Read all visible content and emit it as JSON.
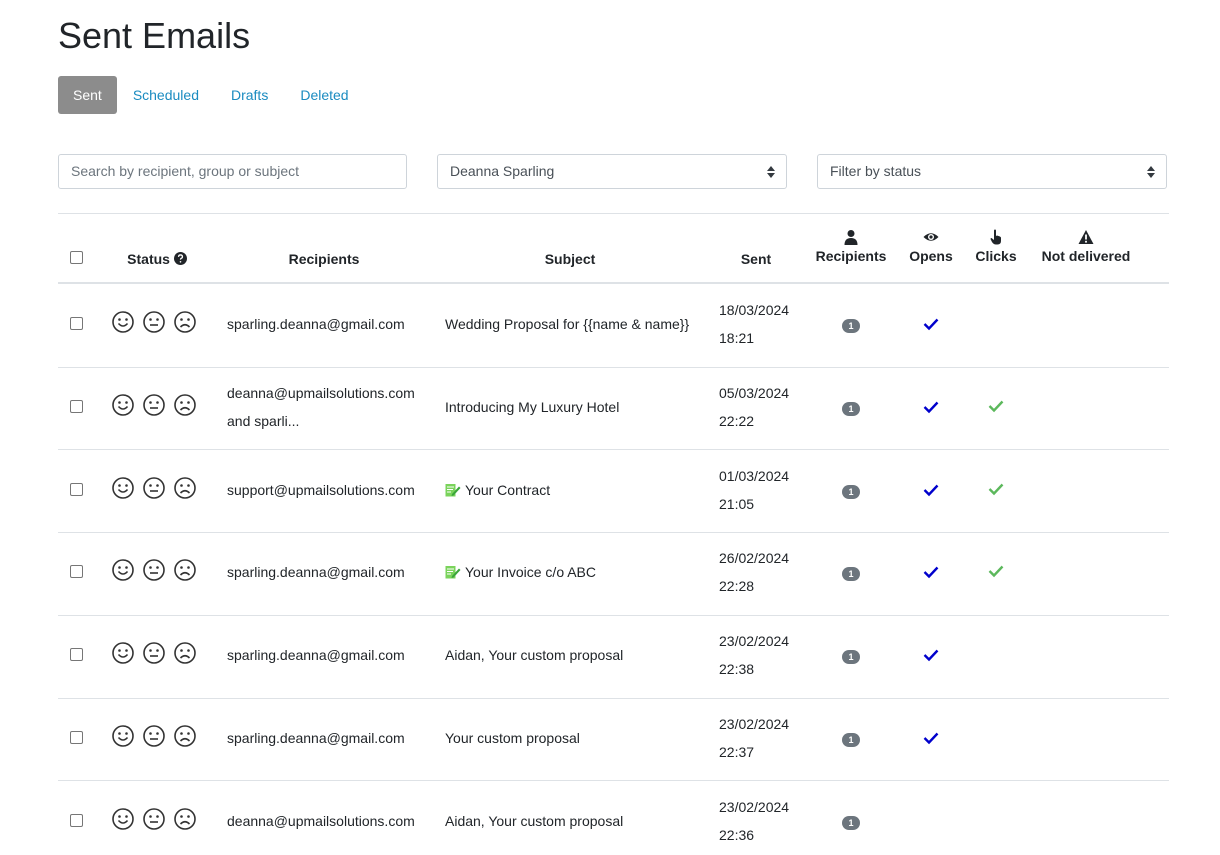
{
  "page": {
    "title": "Sent Emails"
  },
  "tabs": [
    {
      "label": "Sent",
      "active": true
    },
    {
      "label": "Scheduled",
      "active": false
    },
    {
      "label": "Drafts",
      "active": false
    },
    {
      "label": "Deleted",
      "active": false
    }
  ],
  "filters": {
    "search_placeholder": "Search by recipient, group or subject",
    "user_select_value": "Deanna Sparling",
    "status_select_placeholder": "Filter by status"
  },
  "table": {
    "headers": {
      "status": "Status",
      "recipients": "Recipients",
      "subject": "Subject",
      "sent": "Sent",
      "recipients_count": "Recipients",
      "opens": "Opens",
      "clicks": "Clicks",
      "not_delivered": "Not delivered"
    },
    "rows": [
      {
        "recipients_line1": "sparling.deanna@gmail.com",
        "recipients_line2": "",
        "subject": "Wedding Proposal for {{name & name}}",
        "subject_icon": false,
        "sent_date": "18/03/2024",
        "sent_time": "18:21",
        "recipients_count": "1",
        "opened": true,
        "clicked": false
      },
      {
        "recipients_line1": "deanna@upmailsolutions.com",
        "recipients_line2": "and sparli...",
        "subject": "Introducing My Luxury Hotel",
        "subject_icon": false,
        "sent_date": "05/03/2024",
        "sent_time": "22:22",
        "recipients_count": "1",
        "opened": true,
        "clicked": true
      },
      {
        "recipients_line1": "support@upmailsolutions.com",
        "recipients_line2": "",
        "subject": "Your Contract",
        "subject_icon": true,
        "sent_date": "01/03/2024",
        "sent_time": "21:05",
        "recipients_count": "1",
        "opened": true,
        "clicked": true
      },
      {
        "recipients_line1": "sparling.deanna@gmail.com",
        "recipients_line2": "",
        "subject": "Your Invoice c/o ABC",
        "subject_icon": true,
        "sent_date": "26/02/2024",
        "sent_time": "22:28",
        "recipients_count": "1",
        "opened": true,
        "clicked": true
      },
      {
        "recipients_line1": "sparling.deanna@gmail.com",
        "recipients_line2": "",
        "subject": "Aidan, Your custom proposal",
        "subject_icon": false,
        "sent_date": "23/02/2024",
        "sent_time": "22:38",
        "recipients_count": "1",
        "opened": true,
        "clicked": false
      },
      {
        "recipients_line1": "sparling.deanna@gmail.com",
        "recipients_line2": "",
        "subject": "Your custom proposal",
        "subject_icon": false,
        "sent_date": "23/02/2024",
        "sent_time": "22:37",
        "recipients_count": "1",
        "opened": true,
        "clicked": false
      },
      {
        "recipients_line1": "deanna@upmailsolutions.com",
        "recipients_line2": "",
        "subject": "Aidan, Your custom proposal",
        "subject_icon": false,
        "sent_date": "23/02/2024",
        "sent_time": "22:36",
        "recipients_count": "1",
        "opened": false,
        "clicked": false
      }
    ]
  },
  "icons": {
    "status_help": "question-circle-icon",
    "recipients": "user-icon",
    "opens": "eye-icon",
    "clicks": "pointer-hand-icon",
    "not_delivered": "warning-triangle-icon",
    "faces": [
      "smile-face-icon",
      "neutral-face-icon",
      "frown-face-icon"
    ],
    "opened": "blue-check-icon",
    "clicked": "green-check-icon",
    "subject_attachment": "signed-document-icon"
  },
  "colors": {
    "link": "#1a8bc0",
    "active_tab_bg": "#8c8c8c",
    "badge_bg": "#6c757d",
    "opened_check": "#0000cc",
    "clicked_check": "#5cb85c"
  }
}
